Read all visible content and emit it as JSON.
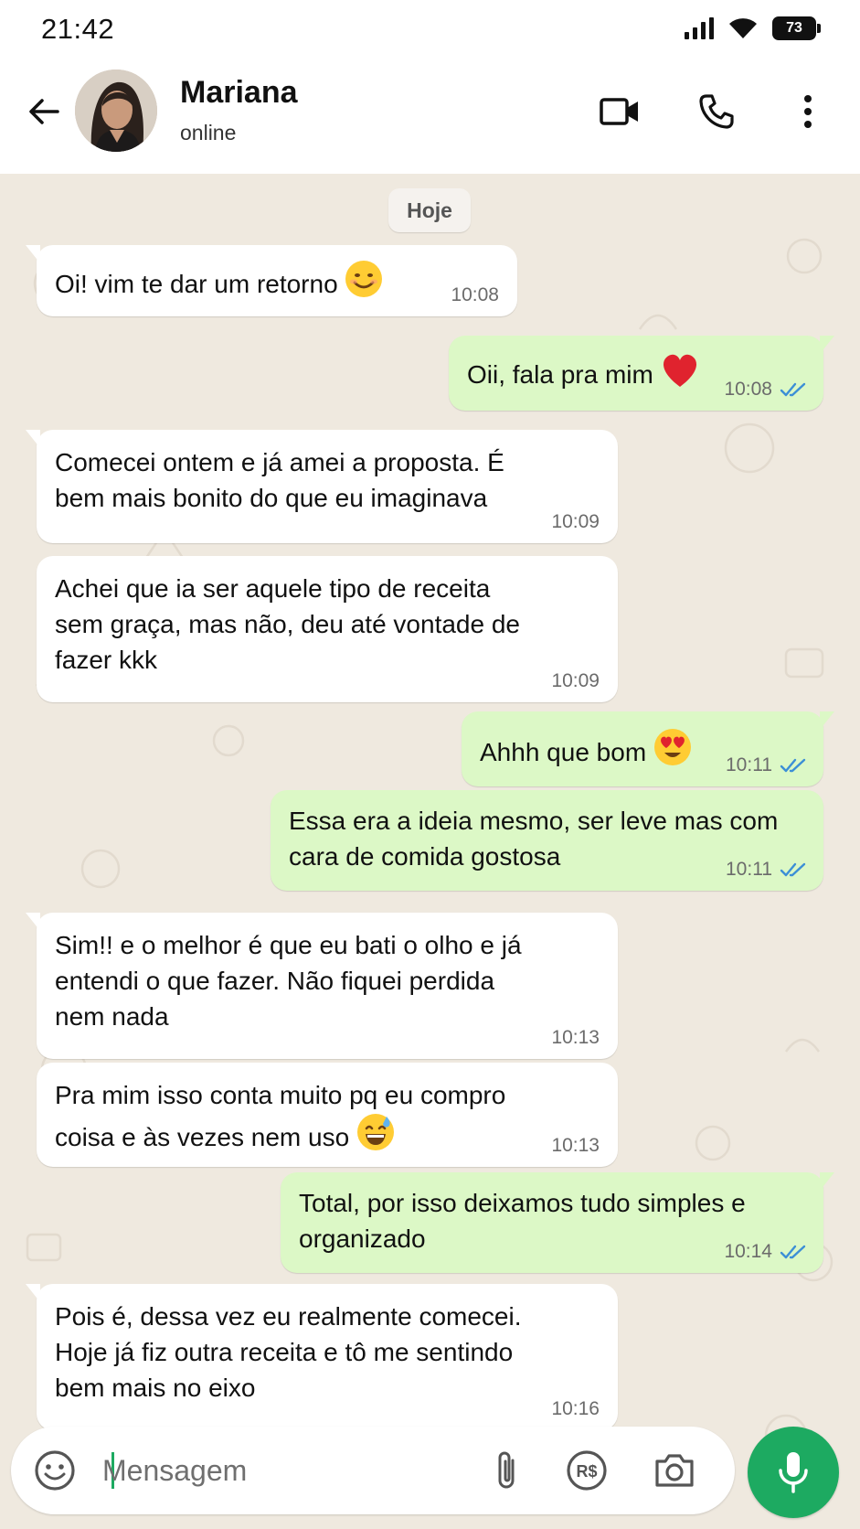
{
  "status_bar": {
    "time": "21:42",
    "battery": "73"
  },
  "header": {
    "contact_name": "Mariana",
    "contact_status": "online"
  },
  "chat": {
    "date_chip": "Hoje",
    "messages": [
      {
        "direction": "in",
        "text": "Oi! vim te dar um retorno",
        "emoji": "smiling-face",
        "time": "10:08"
      },
      {
        "direction": "out",
        "text": "Oii, fala pra mim",
        "emoji": "red-heart",
        "time": "10:08",
        "read": true
      },
      {
        "direction": "in",
        "text": "Comecei ontem e já amei a proposta. É\nbem mais bonito do que eu imaginava",
        "time": "10:09"
      },
      {
        "direction": "in",
        "text": "Achei que ia ser aquele tipo de receita\nsem graça, mas não, deu até vontade de\nfazer kkk",
        "time": "10:09"
      },
      {
        "direction": "out",
        "text": "Ahhh que bom",
        "emoji": "heart-eyes",
        "time": "10:11",
        "read": true
      },
      {
        "direction": "out",
        "text": "Essa era a ideia mesmo, ser leve mas com\ncara de comida gostosa",
        "time": "10:11",
        "read": true
      },
      {
        "direction": "in",
        "text": "Sim!! e o melhor é que eu bati o olho e já\nentendi o que fazer. Não fiquei perdida\nnem nada",
        "time": "10:13"
      },
      {
        "direction": "in",
        "text": "Pra mim isso conta muito pq eu compro\ncoisa e às vezes nem uso",
        "emoji": "grinning-sweat",
        "time": "10:13"
      },
      {
        "direction": "out",
        "text": "Total, por isso deixamos tudo simples e\norganizado",
        "time": "10:14",
        "read": true
      },
      {
        "direction": "in",
        "text": "Pois é, dessa vez eu realmente comecei.\nHoje já fiz outra receita e tô me sentindo\nbem mais no eixo",
        "time": "10:16"
      }
    ]
  },
  "composer": {
    "placeholder": "Mensagem"
  },
  "colors": {
    "accent": "#1daa61",
    "outgoing_bubble": "#dcf8c6",
    "incoming_bubble": "#ffffff",
    "chat_background": "#efe9df",
    "read_ticks": "#3c8fd6"
  }
}
